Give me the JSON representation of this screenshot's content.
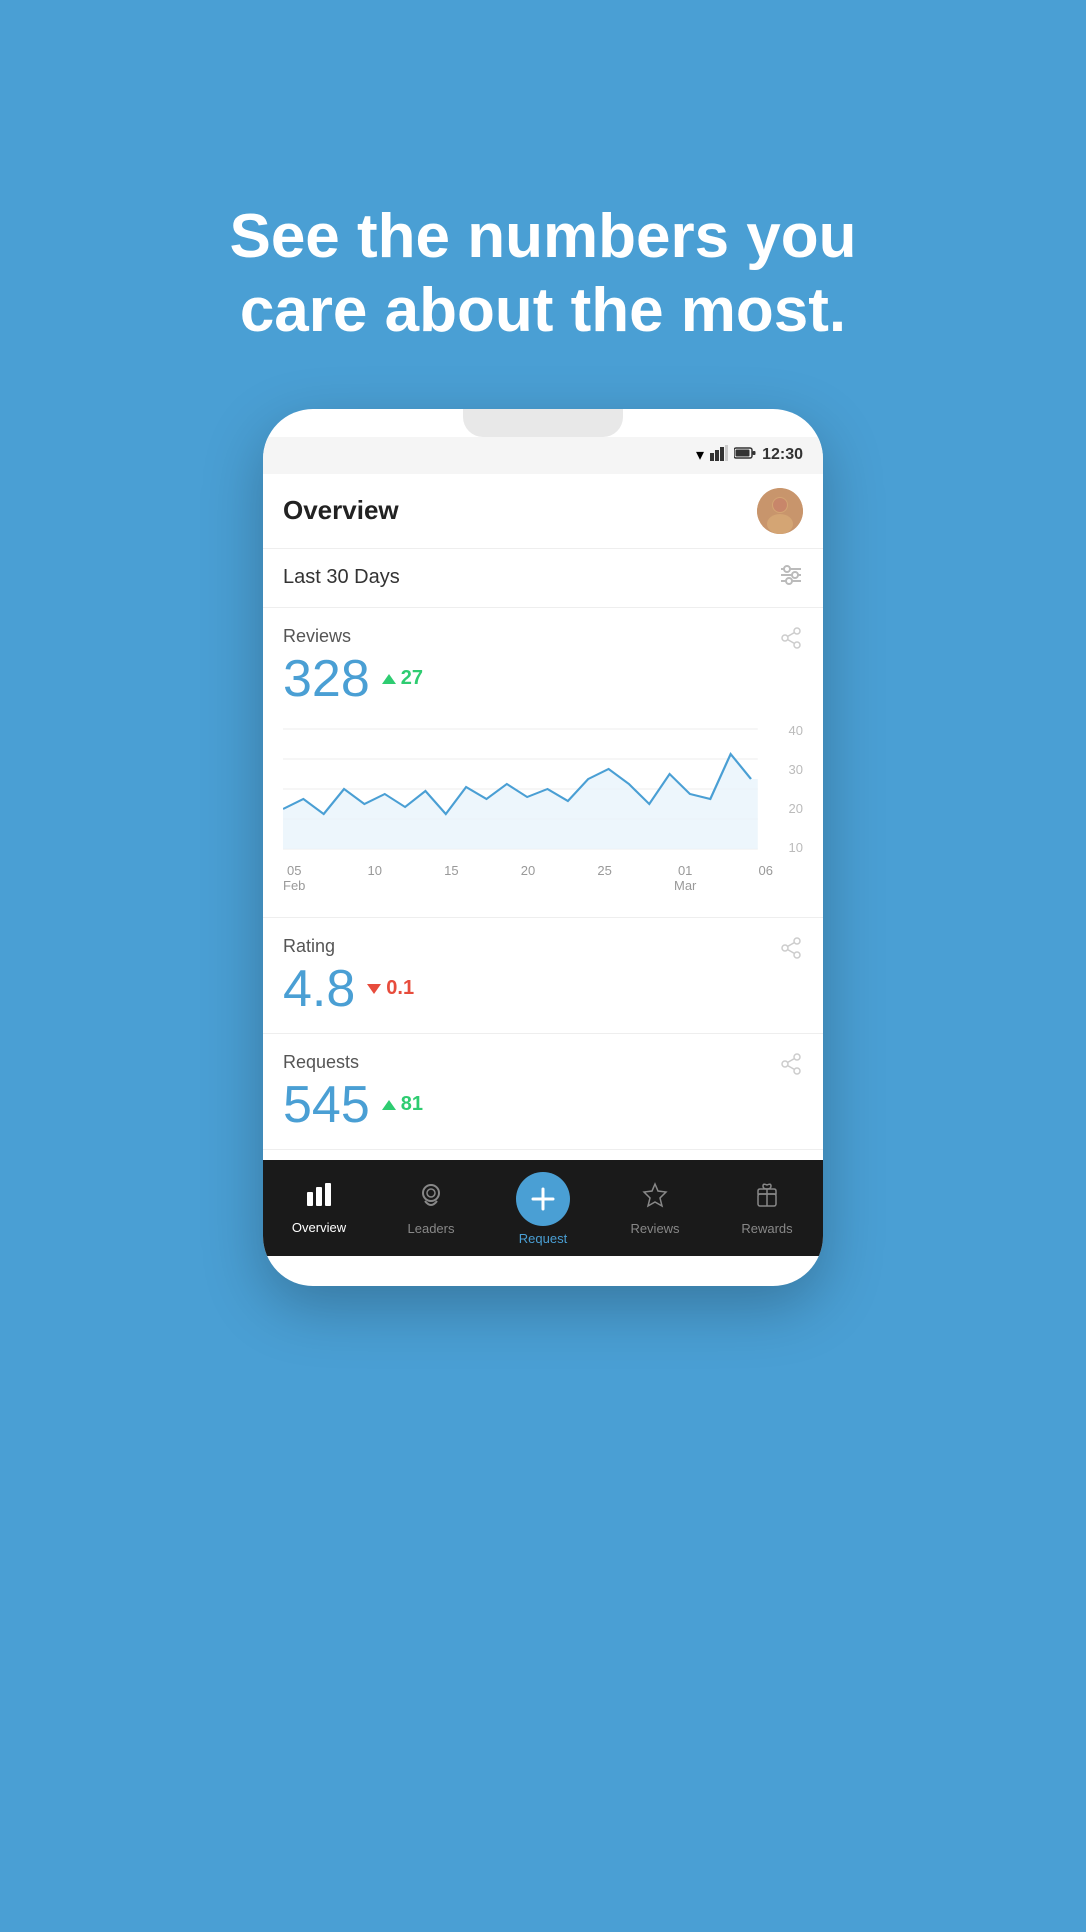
{
  "hero": {
    "text_line1": "See the numbers you",
    "text_line2": "care about the most."
  },
  "status_bar": {
    "time": "12:30",
    "wifi": "▼",
    "signal": "▲",
    "battery": "🔋"
  },
  "header": {
    "title": "Overview",
    "avatar_initial": "👤"
  },
  "period": {
    "label": "Last 30 Days",
    "filter_icon": "⊟"
  },
  "metrics": [
    {
      "id": "reviews",
      "label": "Reviews",
      "value": "328",
      "change": "27",
      "change_direction": "up",
      "has_chart": true,
      "chart": {
        "y_labels": [
          "40",
          "30",
          "20",
          "10"
        ],
        "x_labels": [
          {
            "line1": "05",
            "line2": "Feb"
          },
          {
            "line1": "10",
            "line2": ""
          },
          {
            "line1": "15",
            "line2": ""
          },
          {
            "line1": "20",
            "line2": ""
          },
          {
            "line1": "25",
            "line2": ""
          },
          {
            "line1": "01",
            "line2": "Mar"
          },
          {
            "line1": "06",
            "line2": ""
          }
        ]
      }
    },
    {
      "id": "rating",
      "label": "Rating",
      "value": "4.8",
      "change": "0.1",
      "change_direction": "down",
      "has_chart": false
    },
    {
      "id": "requests",
      "label": "Requests",
      "value": "545",
      "change": "81",
      "change_direction": "up",
      "has_chart": false
    }
  ],
  "nav": {
    "items": [
      {
        "id": "overview",
        "label": "Overview",
        "icon": "bar_chart",
        "active": true
      },
      {
        "id": "leaders",
        "label": "Leaders",
        "icon": "medal",
        "active": false
      },
      {
        "id": "request",
        "label": "Request",
        "icon": "plus",
        "active": false,
        "special": true
      },
      {
        "id": "reviews",
        "label": "Reviews",
        "icon": "star",
        "active": false
      },
      {
        "id": "rewards",
        "label": "Rewards",
        "icon": "gift",
        "active": false
      }
    ]
  }
}
